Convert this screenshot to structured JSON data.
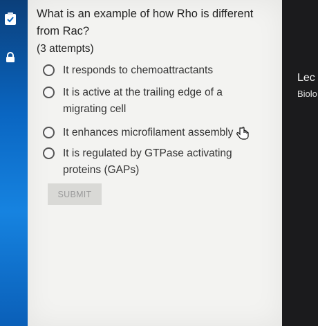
{
  "sidebar": {
    "icons": [
      "clipboard-check-icon",
      "lock-icon"
    ]
  },
  "question": {
    "text": "What is an example of how Rho is different from Rac?",
    "attempts": "(3 attempts)",
    "options": [
      {
        "label": "It responds to chemoattractants"
      },
      {
        "label": "It is active at the trailing edge of a migrating cell"
      },
      {
        "label": "It enhances microfilament assembly"
      },
      {
        "label": "It is regulated by GTPase activating proteins (GAPs)"
      }
    ],
    "submit_label": "SUBMIT"
  },
  "right_panel": {
    "title": "Lec",
    "subtitle": "Biolo"
  },
  "colors": {
    "sidebar_blue": "#0a66c2",
    "card_bg": "#f3f3f1",
    "right_panel_bg": "#1b1b1d"
  }
}
